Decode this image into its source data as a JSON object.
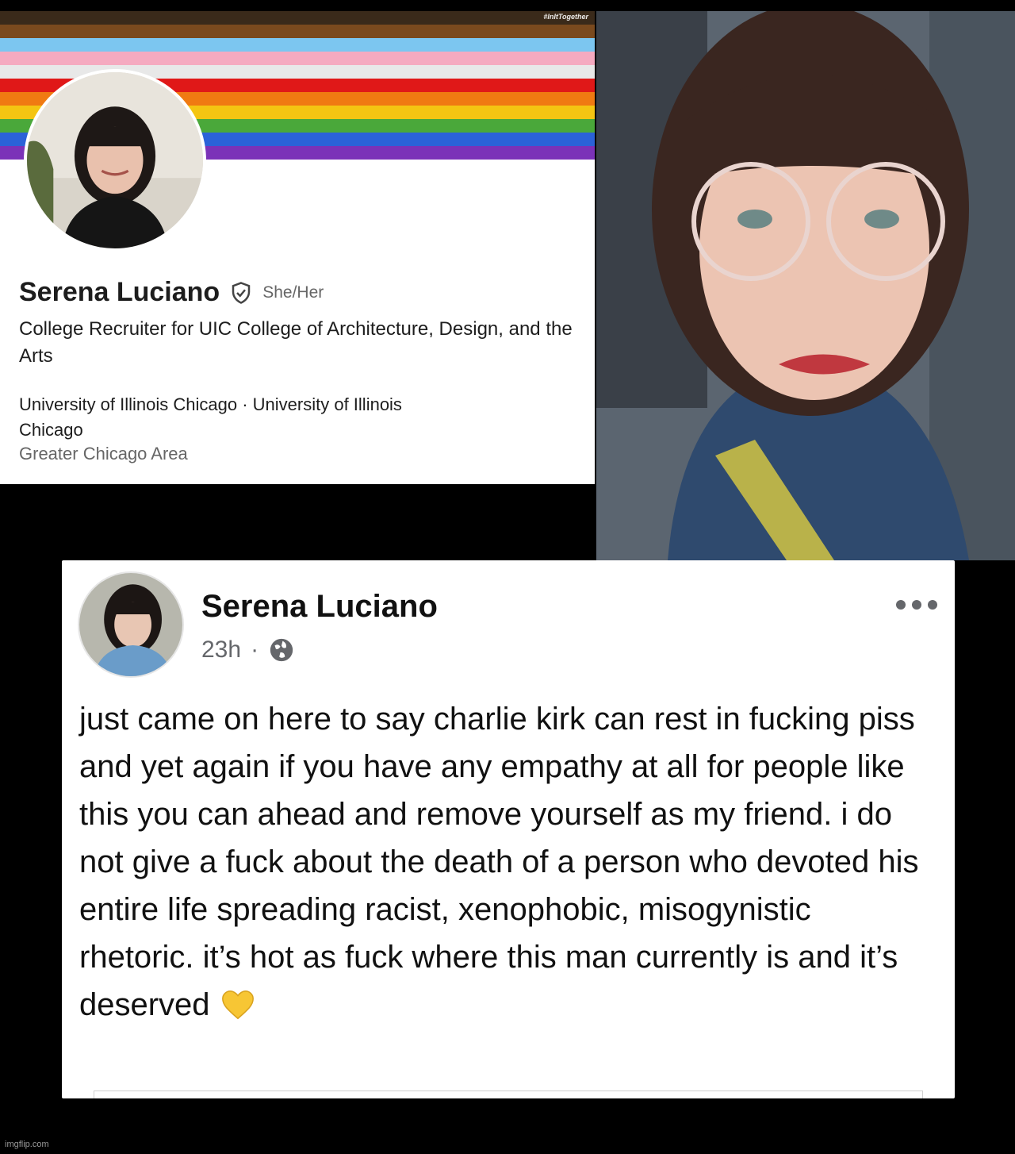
{
  "profile": {
    "banner_tag": "#InItTogether",
    "banner_colors": [
      "#3a2a1a",
      "#7a4a1e",
      "#7cc6f0",
      "#f5aac0",
      "#e8e8e8",
      "#e01818",
      "#f07a12",
      "#f4c512",
      "#4aa83a",
      "#2b62d8",
      "#7b32b8"
    ],
    "name": "Serena Luciano",
    "pronouns": "She/Her",
    "headline": "College Recruiter for UIC College of Architecture, Design, and the Arts",
    "education": "University of Illinois Chicago · University of Illinois Chicago",
    "location": "Greater Chicago Area"
  },
  "post": {
    "author": "Serena Luciano",
    "time": "23h",
    "separator": "·",
    "body": "just came on here to say charlie kirk can rest in fucking piss and yet again if you have any empathy at all for people like this you can ahead and remove yourself as my friend. i do not give a fuck about the death of a person who devoted his entire life spreading racist, xenophobic, misogynistic rhetoric. it’s hot as fuck where this man currently is and it’s deserved",
    "trailing_emoji": "yellow-heart-icon"
  },
  "watermark": "imgflip.com"
}
